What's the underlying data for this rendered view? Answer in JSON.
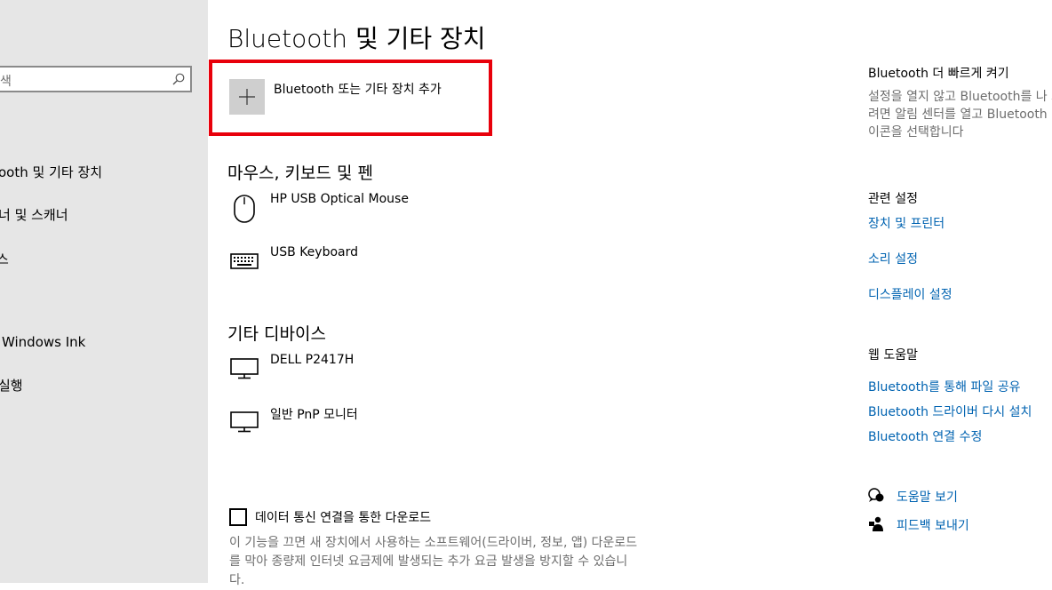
{
  "sidebar": {
    "search_placeholder": "색",
    "items": [
      {
        "label": "ooth 및 기타 장치"
      },
      {
        "label": "너 및 스캐너"
      },
      {
        "label": "스"
      },
      {
        "label": "Windows Ink"
      },
      {
        "label": "실행"
      }
    ]
  },
  "main": {
    "title": "Bluetooth 및 기타 장치",
    "add_device_label": "Bluetooth 또는 기타 장치 추가",
    "mouse_section": {
      "heading": "마우스, 키보드 및 펜",
      "devices": [
        {
          "name": "HP USB Optical Mouse",
          "icon": "mouse-icon"
        },
        {
          "name": "USB Keyboard",
          "icon": "keyboard-icon"
        }
      ]
    },
    "other_section": {
      "heading": "기타 디바이스",
      "devices": [
        {
          "name": "DELL P2417H",
          "icon": "monitor-icon"
        },
        {
          "name": "일반 PnP 모니터",
          "icon": "monitor-icon"
        }
      ]
    },
    "metered": {
      "label": "데이터 통신 연결을 통한 다운로드",
      "checked": false,
      "description": "이 기능을 끄면 새 장치에서 사용하는 소프트웨어(드라이버, 정보, 앱) 다운로드를 막아 종량제 인터넷 요금제에 발생되는 추가 요금 발생을 방지할 수 있습니다."
    }
  },
  "right": {
    "faster_heading": "Bluetooth 더 빠르게 켜기",
    "faster_text": "설정을 열지 않고 Bluetooth를 나 끄려면 알림 센터를 열고 Bluetooth 아이콘을 선택합니다",
    "related_heading": "관련 설정",
    "related_links": [
      "장치 및 프린터",
      "소리 설정",
      "디스플레이 설정"
    ],
    "web_help_heading": "웹 도움말",
    "web_help_links": [
      "Bluetooth를 통해 파일 공유",
      "Bluetooth 드라이버 다시 설치",
      "Bluetooth 연결 수정"
    ],
    "get_help": "도움말 보기",
    "feedback": "피드백 보내기"
  },
  "colors": {
    "highlight": "#e8000b",
    "link": "#0063b1",
    "sidebar": "#e6e6e6"
  }
}
